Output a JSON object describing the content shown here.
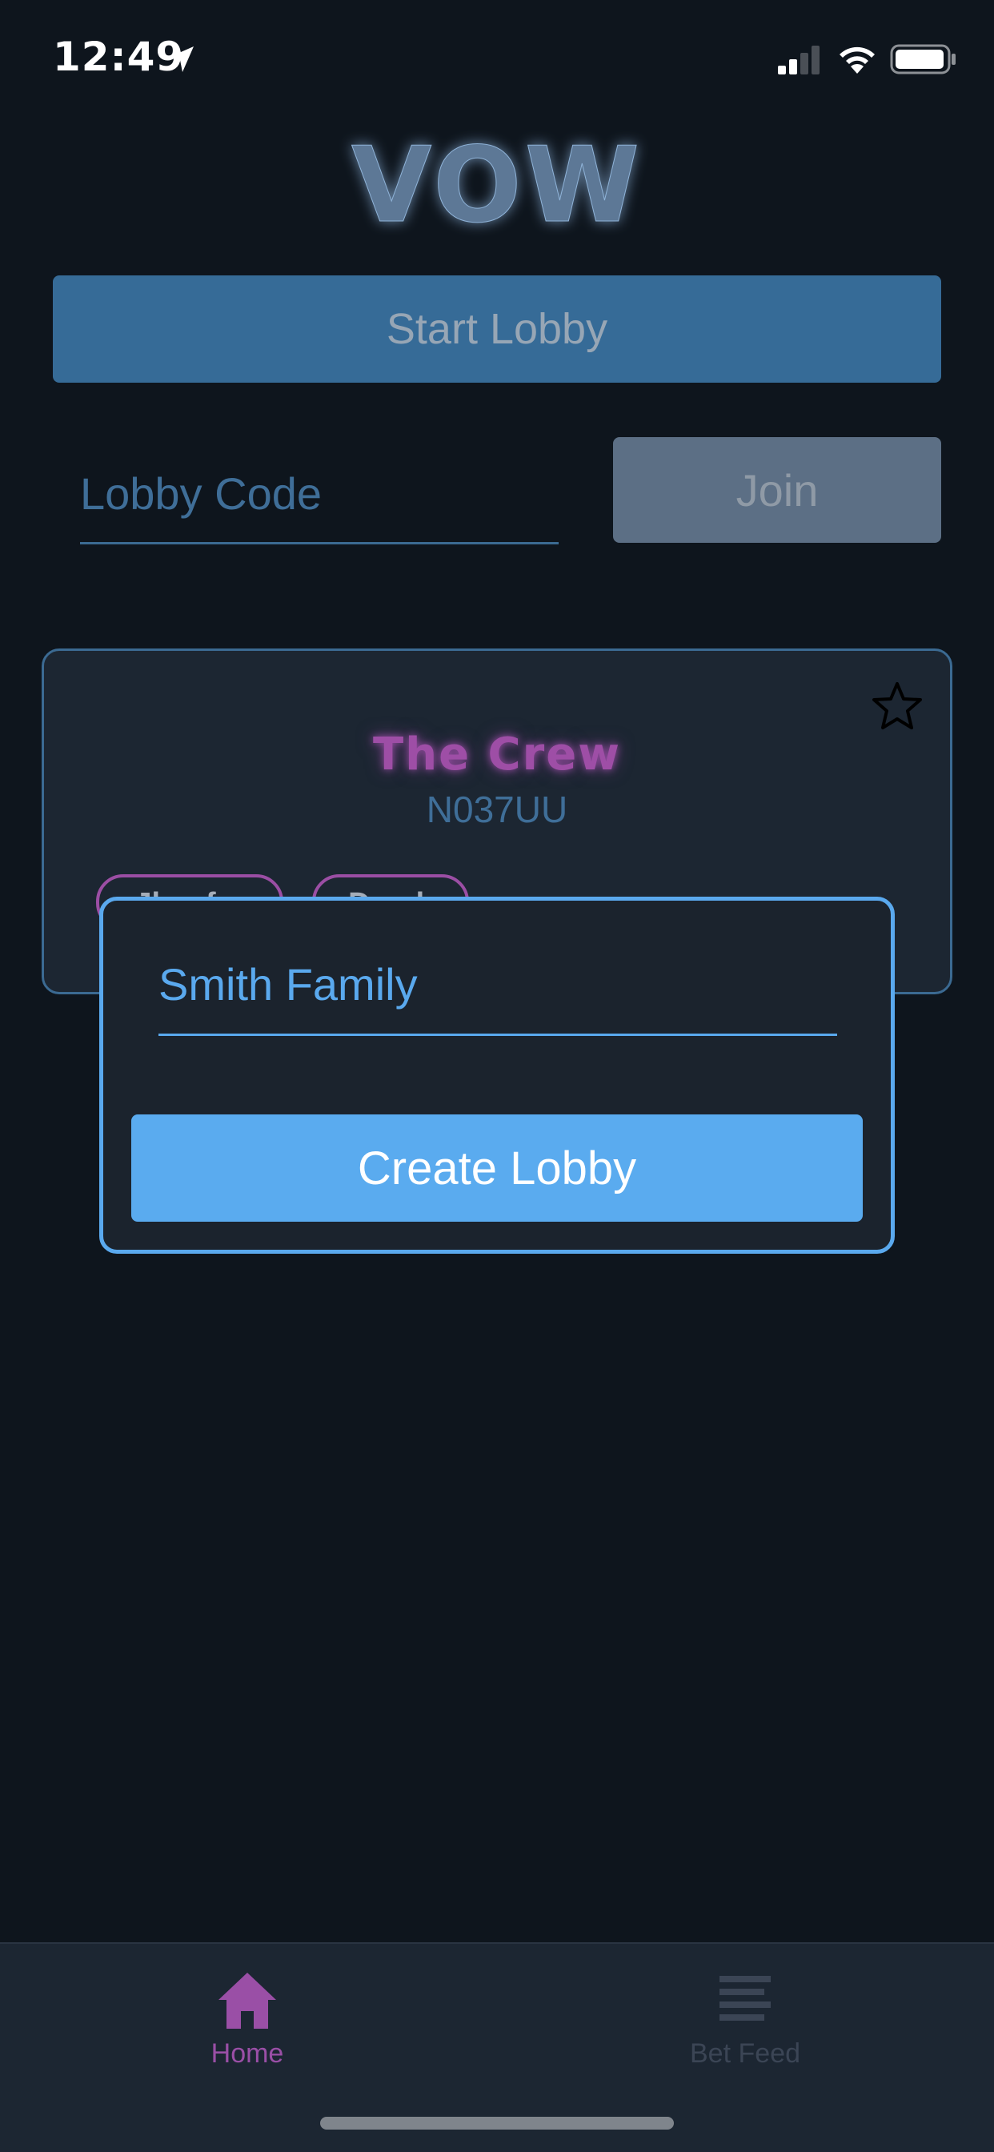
{
  "status_bar": {
    "time": "12:49"
  },
  "app": {
    "logo_text": "VOW"
  },
  "actions": {
    "start_lobby_label": "Start Lobby",
    "lobby_code_placeholder": "Lobby Code",
    "join_label": "Join"
  },
  "lobby_card": {
    "name": "The Crew",
    "code": "N037UU",
    "favorited": false,
    "members": [
      "Jhenfer",
      "Derek"
    ]
  },
  "create_popup": {
    "lobby_name_value": "Smith Family",
    "create_label": "Create Lobby"
  },
  "tab_bar": {
    "tabs": [
      {
        "label": "Home",
        "icon": "home-icon",
        "active": true
      },
      {
        "label": "Bet Feed",
        "icon": "list-icon",
        "active": false
      }
    ]
  },
  "colors": {
    "background": "#0e151d",
    "primary": "#5aabef",
    "accent": "#9b4ea4",
    "card": "#1c2632"
  }
}
